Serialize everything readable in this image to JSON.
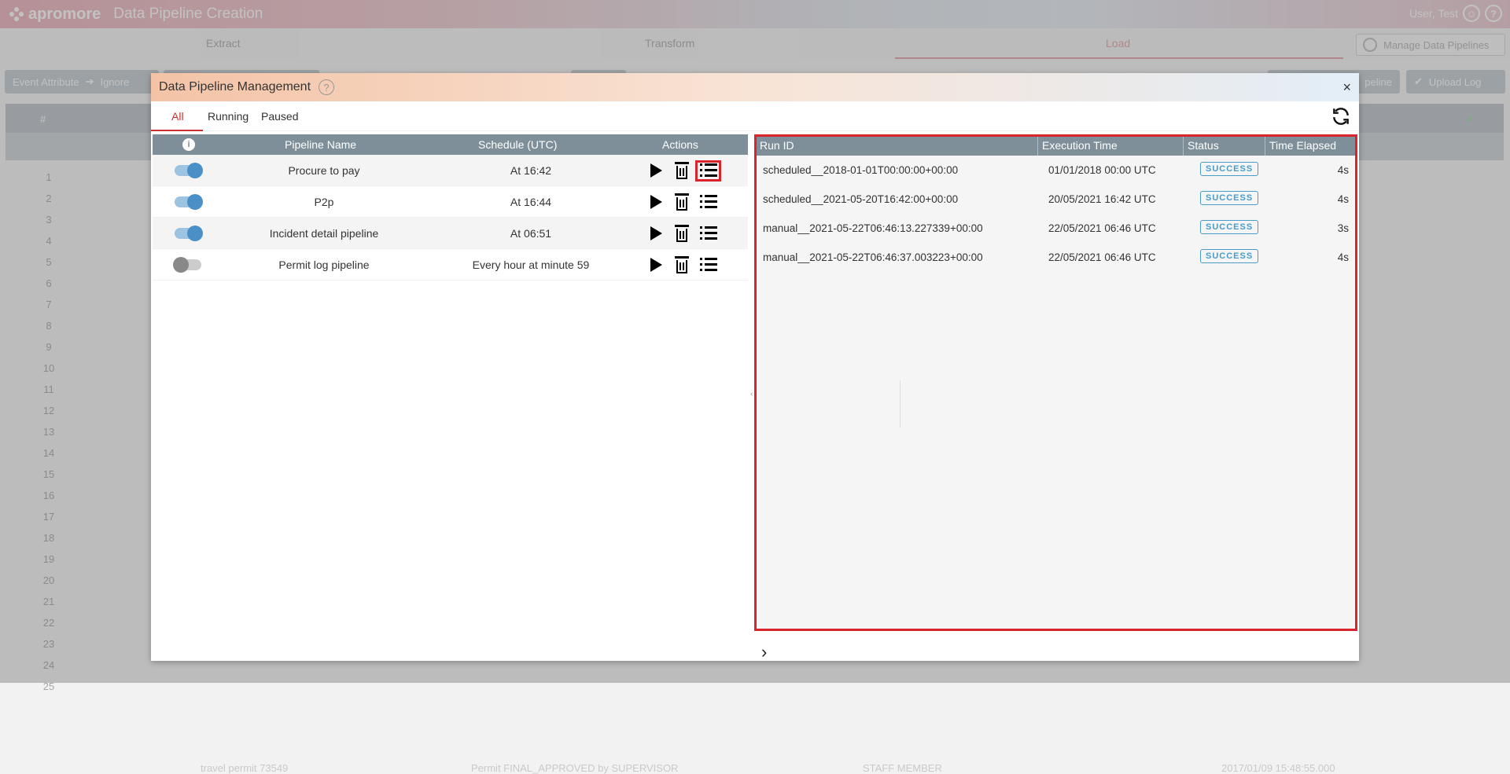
{
  "app": {
    "logo_text": "apromore",
    "title": "Data Pipeline Creation",
    "user": "User, Test"
  },
  "stages": [
    "Extract",
    "Transform",
    "Load"
  ],
  "manage_button": "Manage Data Pipelines",
  "background": {
    "toolbar": {
      "attr_button": "Event Attribute",
      "ignore_button": "Ignore",
      "pipeline_button": "peline",
      "upload_button": "Upload Log"
    },
    "table": {
      "hash": "#",
      "row_numbers": [
        "1",
        "2",
        "3",
        "4",
        "5",
        "6",
        "7",
        "8",
        "9",
        "10",
        "11",
        "12",
        "13",
        "14",
        "15",
        "16",
        "17",
        "18",
        "19",
        "20",
        "21",
        "22",
        "23",
        "24",
        "25"
      ],
      "row24": {
        "case": "travel permit 73549",
        "activity": "Permit FINAL_APPROVED by SUPERVISOR",
        "resource": "STAFF MEMBER",
        "time": "2017/01/09 15:48:55.000"
      }
    }
  },
  "modal": {
    "title": "Data Pipeline Management",
    "close": "×",
    "tabs": [
      "All",
      "Running",
      "Paused"
    ],
    "pipelines": {
      "headers": {
        "info": "i",
        "name": "Pipeline Name",
        "schedule": "Schedule (UTC)",
        "actions": "Actions"
      },
      "rows": [
        {
          "enabled": true,
          "name": "Procure to pay",
          "schedule": "At 16:42"
        },
        {
          "enabled": true,
          "name": "P2p",
          "schedule": "At 16:44"
        },
        {
          "enabled": true,
          "name": "Incident detail pipeline",
          "schedule": "At 06:51"
        },
        {
          "enabled": false,
          "name": "Permit log pipeline",
          "schedule": "Every hour at minute 59"
        }
      ]
    },
    "runs": {
      "headers": {
        "run_id": "Run ID",
        "exec_time": "Execution Time",
        "status": "Status",
        "elapsed": "Time Elapsed"
      },
      "rows": [
        {
          "run_id": "scheduled__2018-01-01T00:00:00+00:00",
          "exec_time": "01/01/2018 00:00 UTC",
          "status": "SUCCESS",
          "elapsed": "4s"
        },
        {
          "run_id": "scheduled__2021-05-20T16:42:00+00:00",
          "exec_time": "20/05/2021 16:42 UTC",
          "status": "SUCCESS",
          "elapsed": "4s"
        },
        {
          "run_id": "manual__2021-05-22T06:46:13.227339+00:00",
          "exec_time": "22/05/2021 06:46 UTC",
          "status": "SUCCESS",
          "elapsed": "3s"
        },
        {
          "run_id": "manual__2021-05-22T06:46:37.003223+00:00",
          "exec_time": "22/05/2021 06:46 UTC",
          "status": "SUCCESS",
          "elapsed": "4s"
        }
      ]
    },
    "next_icon": "›"
  }
}
